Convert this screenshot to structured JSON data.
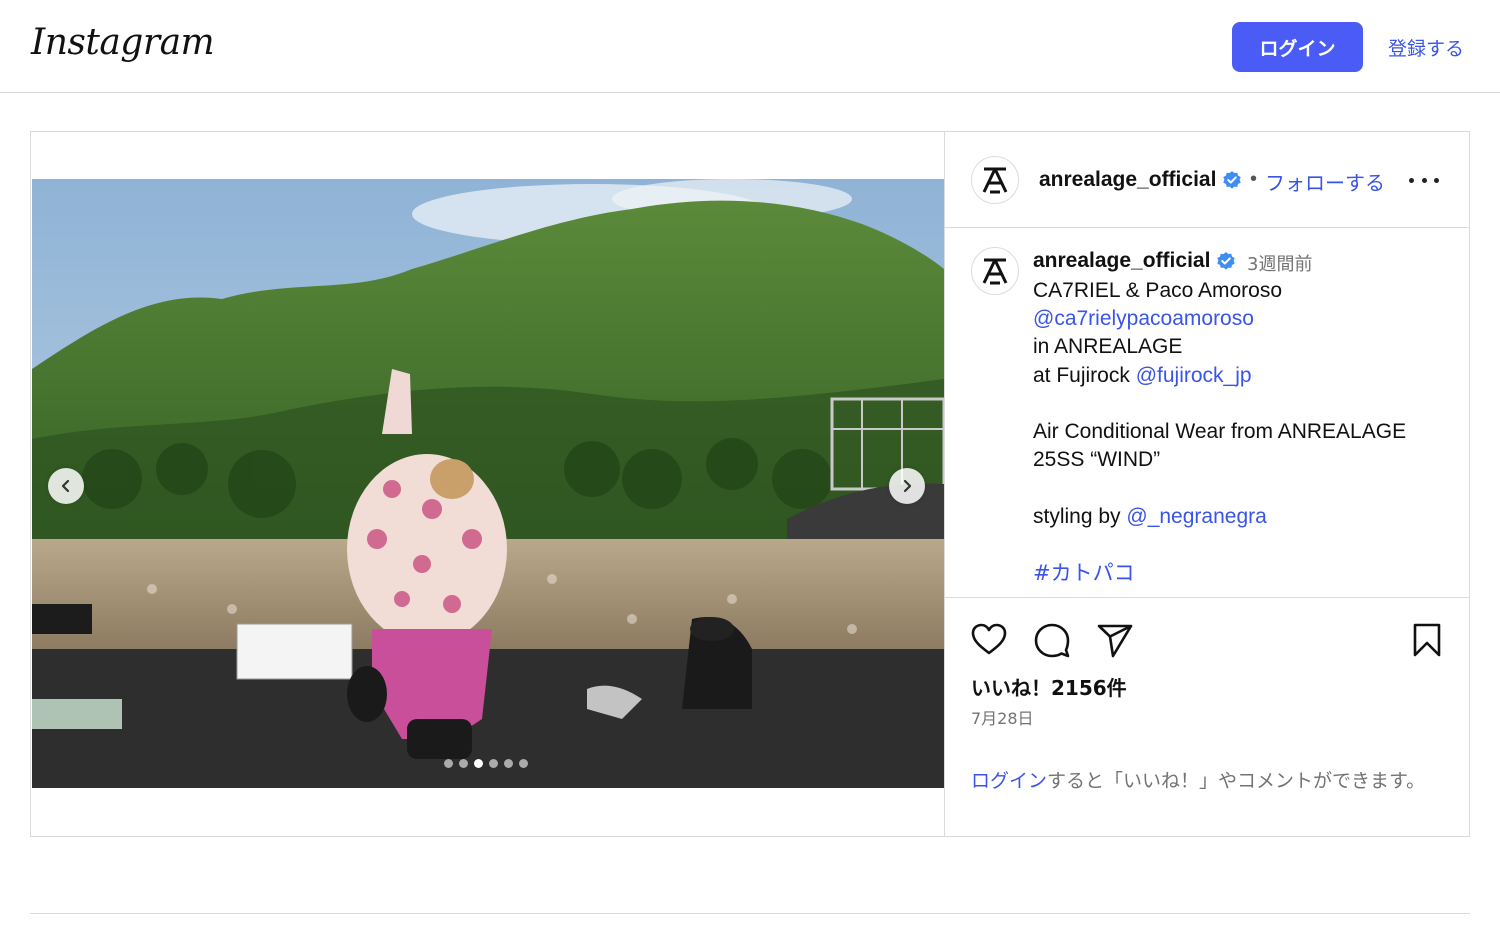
{
  "header": {
    "logo_text": "Instagram",
    "login_label": "ログイン",
    "signup_label": "登録する"
  },
  "post": {
    "carousel": {
      "total_slides": 6,
      "active_slide": 3
    },
    "author": {
      "username": "anrealage_official",
      "verified": true,
      "follow_label": "フォローする",
      "separator": "•"
    },
    "caption": {
      "username": "anrealage_official",
      "time_ago": "3週間前",
      "lines": [
        [
          {
            "t": "CA7RIEL & Paco Amoroso"
          }
        ],
        [
          {
            "t": "@ca7rielypacoamoroso",
            "link": true
          }
        ],
        [
          {
            "t": "in ANREALAGE"
          }
        ],
        [
          {
            "t": "at Fujirock "
          },
          {
            "t": "@fujirock_jp",
            "link": true
          }
        ],
        [
          {
            "t": ""
          }
        ],
        [
          {
            "t": "Air Conditional Wear from ANREALAGE"
          }
        ],
        [
          {
            "t": "25SS “WIND”"
          }
        ],
        [
          {
            "t": ""
          }
        ],
        [
          {
            "t": "styling by "
          },
          {
            "t": "@_negranegra",
            "link": true
          }
        ],
        [
          {
            "t": ""
          }
        ],
        [
          {
            "t": "#カトパコ",
            "tag": true
          }
        ]
      ]
    },
    "likes_label": "いいね！2156件",
    "date_label": "7月28日",
    "login_prompt": {
      "link": "ログイン",
      "text": "すると「いいね！」やコメントができます。"
    }
  },
  "icons": {
    "verified": "verified-badge-icon",
    "like": "heart-icon",
    "comment": "comment-bubble-icon",
    "share": "paper-plane-icon",
    "save": "bookmark-icon",
    "more": "more-horizontal-icon",
    "prev": "chevron-left-icon",
    "next": "chevron-right-icon"
  },
  "colors": {
    "accent": "#4a5cf5",
    "link": "#3a54e8",
    "verified": "#3f8cf4",
    "muted": "#737373",
    "border": "#dbdbdb"
  }
}
